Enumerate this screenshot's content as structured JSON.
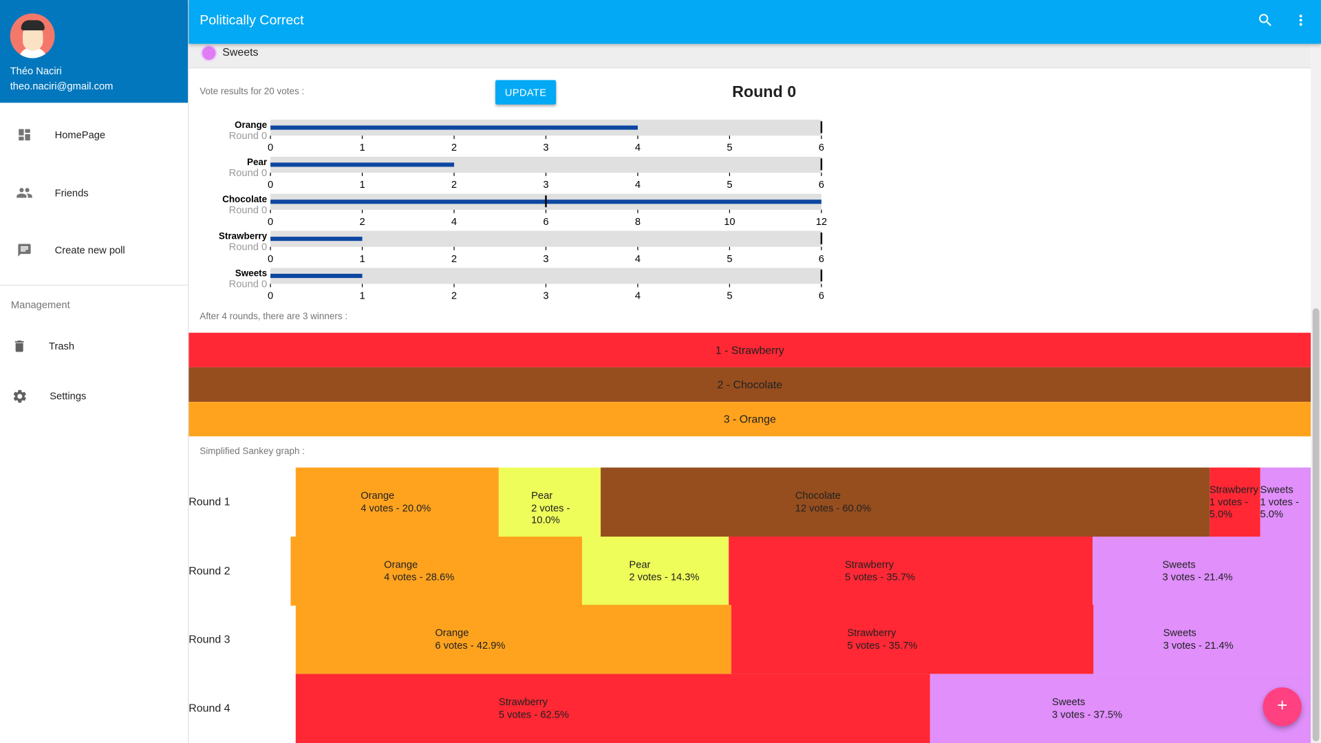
{
  "app": {
    "title": "Politically Correct"
  },
  "user": {
    "name": "Théo Naciri",
    "email": "theo.naciri@gmail.com"
  },
  "sidebar": {
    "items": [
      {
        "label": "HomePage",
        "icon": "dashboard-icon"
      },
      {
        "label": "Friends",
        "icon": "people-icon"
      },
      {
        "label": "Create new poll",
        "icon": "message-icon"
      }
    ],
    "section_label": "Management",
    "management_items": [
      {
        "label": "Trash",
        "icon": "trash-icon"
      },
      {
        "label": "Settings",
        "icon": "gear-icon"
      }
    ]
  },
  "poll": {
    "option_label": "Sweets",
    "vote_results_text": "Vote results for 20 votes :",
    "update_label": "UPDATE",
    "round_title": "Round 0"
  },
  "chart_data": {
    "type": "bar",
    "round_label": "Round 0",
    "bars": [
      {
        "name": "Orange",
        "value": 4,
        "max": 6,
        "ticks": [
          0,
          1,
          2,
          3,
          4,
          5,
          6
        ]
      },
      {
        "name": "Pear",
        "value": 2,
        "max": 6,
        "ticks": [
          0,
          1,
          2,
          3,
          4,
          5,
          6
        ]
      },
      {
        "name": "Chocolate",
        "value": 12,
        "max": 12,
        "ticks": [
          0,
          2,
          4,
          6,
          8,
          10,
          12
        ]
      },
      {
        "name": "Strawberry",
        "value": 1,
        "max": 6,
        "ticks": [
          0,
          1,
          2,
          3,
          4,
          5,
          6
        ]
      },
      {
        "name": "Sweets",
        "value": 1,
        "max": 6,
        "ticks": [
          0,
          1,
          2,
          3,
          4,
          5,
          6
        ]
      }
    ],
    "colors": {
      "bar": "#0d47a1",
      "track": "#e0e0e0"
    }
  },
  "winners": {
    "text": "After 4 rounds, there are 3 winners :",
    "list": [
      {
        "label": "1 - Strawberry",
        "color": "#ff2834"
      },
      {
        "label": "2 - Chocolate",
        "color": "#964e1f"
      },
      {
        "label": "3 - Orange",
        "color": "#ffa31f"
      }
    ]
  },
  "sankey": {
    "title": "Simplified Sankey graph :",
    "colors": {
      "Orange": "#ffa31f",
      "Pear": "#eefd5a",
      "Chocolate": "#964e1f",
      "Strawberry": "#ff2834",
      "Sweets": "#e08ffb"
    },
    "rounds": [
      {
        "label": "Round 1",
        "blocks": [
          {
            "name": "Orange",
            "votes_text": "4 votes - 20.0%",
            "votes": 4,
            "share": 20.0
          },
          {
            "name": "Pear",
            "votes_text": "2 votes - 10.0%",
            "votes": 2,
            "share": 10.0
          },
          {
            "name": "Chocolate",
            "votes_text": "12 votes - 60.0%",
            "votes": 12,
            "share": 60.0
          },
          {
            "name": "Strawberry",
            "votes_text": "1 votes - 5.0%",
            "votes": 1,
            "share": 5.0
          },
          {
            "name": "Sweets",
            "votes_text": "1 votes - 5.0%",
            "votes": 1,
            "share": 5.0
          }
        ]
      },
      {
        "label": "Round 2",
        "blocks": [
          {
            "name": "Orange",
            "votes_text": "4 votes - 28.6%",
            "votes": 4,
            "share": 28.6
          },
          {
            "name": "Pear",
            "votes_text": "2 votes - 14.3%",
            "votes": 2,
            "share": 14.3
          },
          {
            "name": "Strawberry",
            "votes_text": "5 votes - 35.7%",
            "votes": 5,
            "share": 35.7
          },
          {
            "name": "Sweets",
            "votes_text": "3 votes - 21.4%",
            "votes": 3,
            "share": 21.4
          }
        ]
      },
      {
        "label": "Round 3",
        "blocks": [
          {
            "name": "Orange",
            "votes_text": "6 votes - 42.9%",
            "votes": 6,
            "share": 42.9
          },
          {
            "name": "Strawberry",
            "votes_text": "5 votes - 35.7%",
            "votes": 5,
            "share": 35.7
          },
          {
            "name": "Sweets",
            "votes_text": "3 votes - 21.4%",
            "votes": 3,
            "share": 21.4
          }
        ]
      },
      {
        "label": "Round 4",
        "blocks": [
          {
            "name": "Strawberry",
            "votes_text": "5 votes - 62.5%",
            "votes": 5,
            "share": 62.5
          },
          {
            "name": "Sweets",
            "votes_text": "3 votes - 37.5%",
            "votes": 3,
            "share": 37.5
          }
        ]
      }
    ]
  },
  "fab": {
    "icon": "plus-icon",
    "label": "+"
  }
}
